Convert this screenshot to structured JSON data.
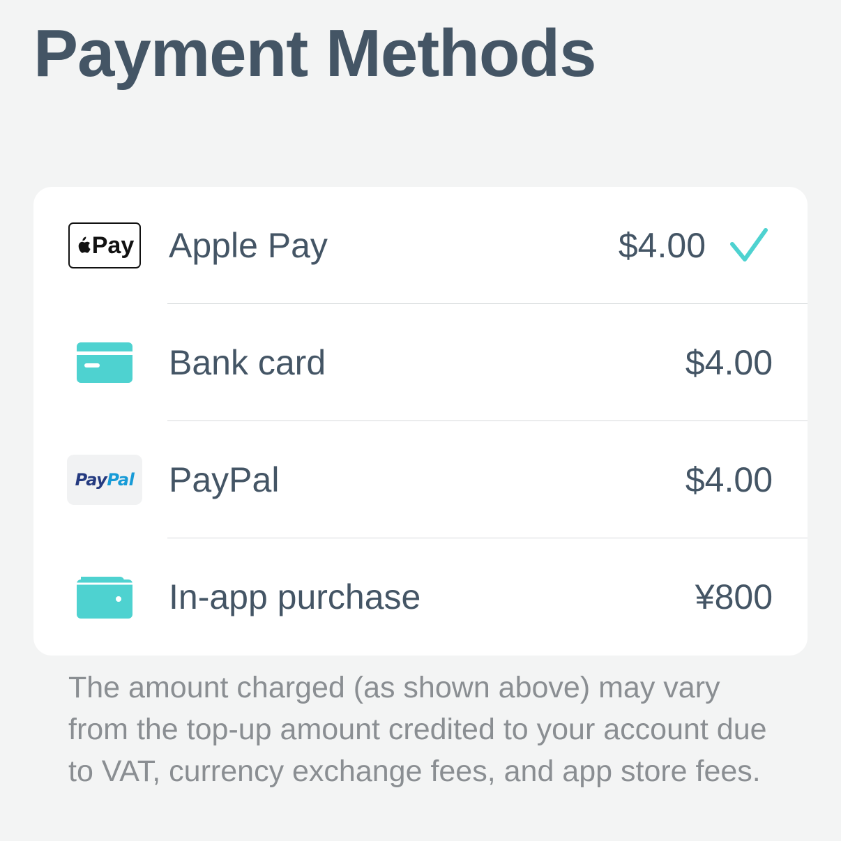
{
  "page": {
    "title": "Payment Methods"
  },
  "colors": {
    "background": "#f3f4f4",
    "card": "#ffffff",
    "text_primary": "#445565",
    "text_secondary": "#8a8e92",
    "accent_teal": "#4ed2d0"
  },
  "payment_methods": [
    {
      "id": "apple-pay",
      "icon": "apple-pay-badge",
      "badge_text": "Pay",
      "label": "Apple Pay",
      "price": "$4.00",
      "selected": true
    },
    {
      "id": "bank-card",
      "icon": "credit-card-icon",
      "label": "Bank card",
      "price": "$4.00",
      "selected": false
    },
    {
      "id": "paypal",
      "icon": "paypal-logo",
      "logo_pay": "Pay",
      "logo_pal": "Pal",
      "label": "PayPal",
      "price": "$4.00",
      "selected": false
    },
    {
      "id": "in-app-purchase",
      "icon": "wallet-icon",
      "label": "In-app purchase",
      "price": "¥800",
      "selected": false
    }
  ],
  "selection_indicator": "checkmark-icon",
  "disclaimer": "The amount charged (as shown above) may vary from the top-up amount credited to your account due to VAT, currency exchange fees, and app store fees."
}
